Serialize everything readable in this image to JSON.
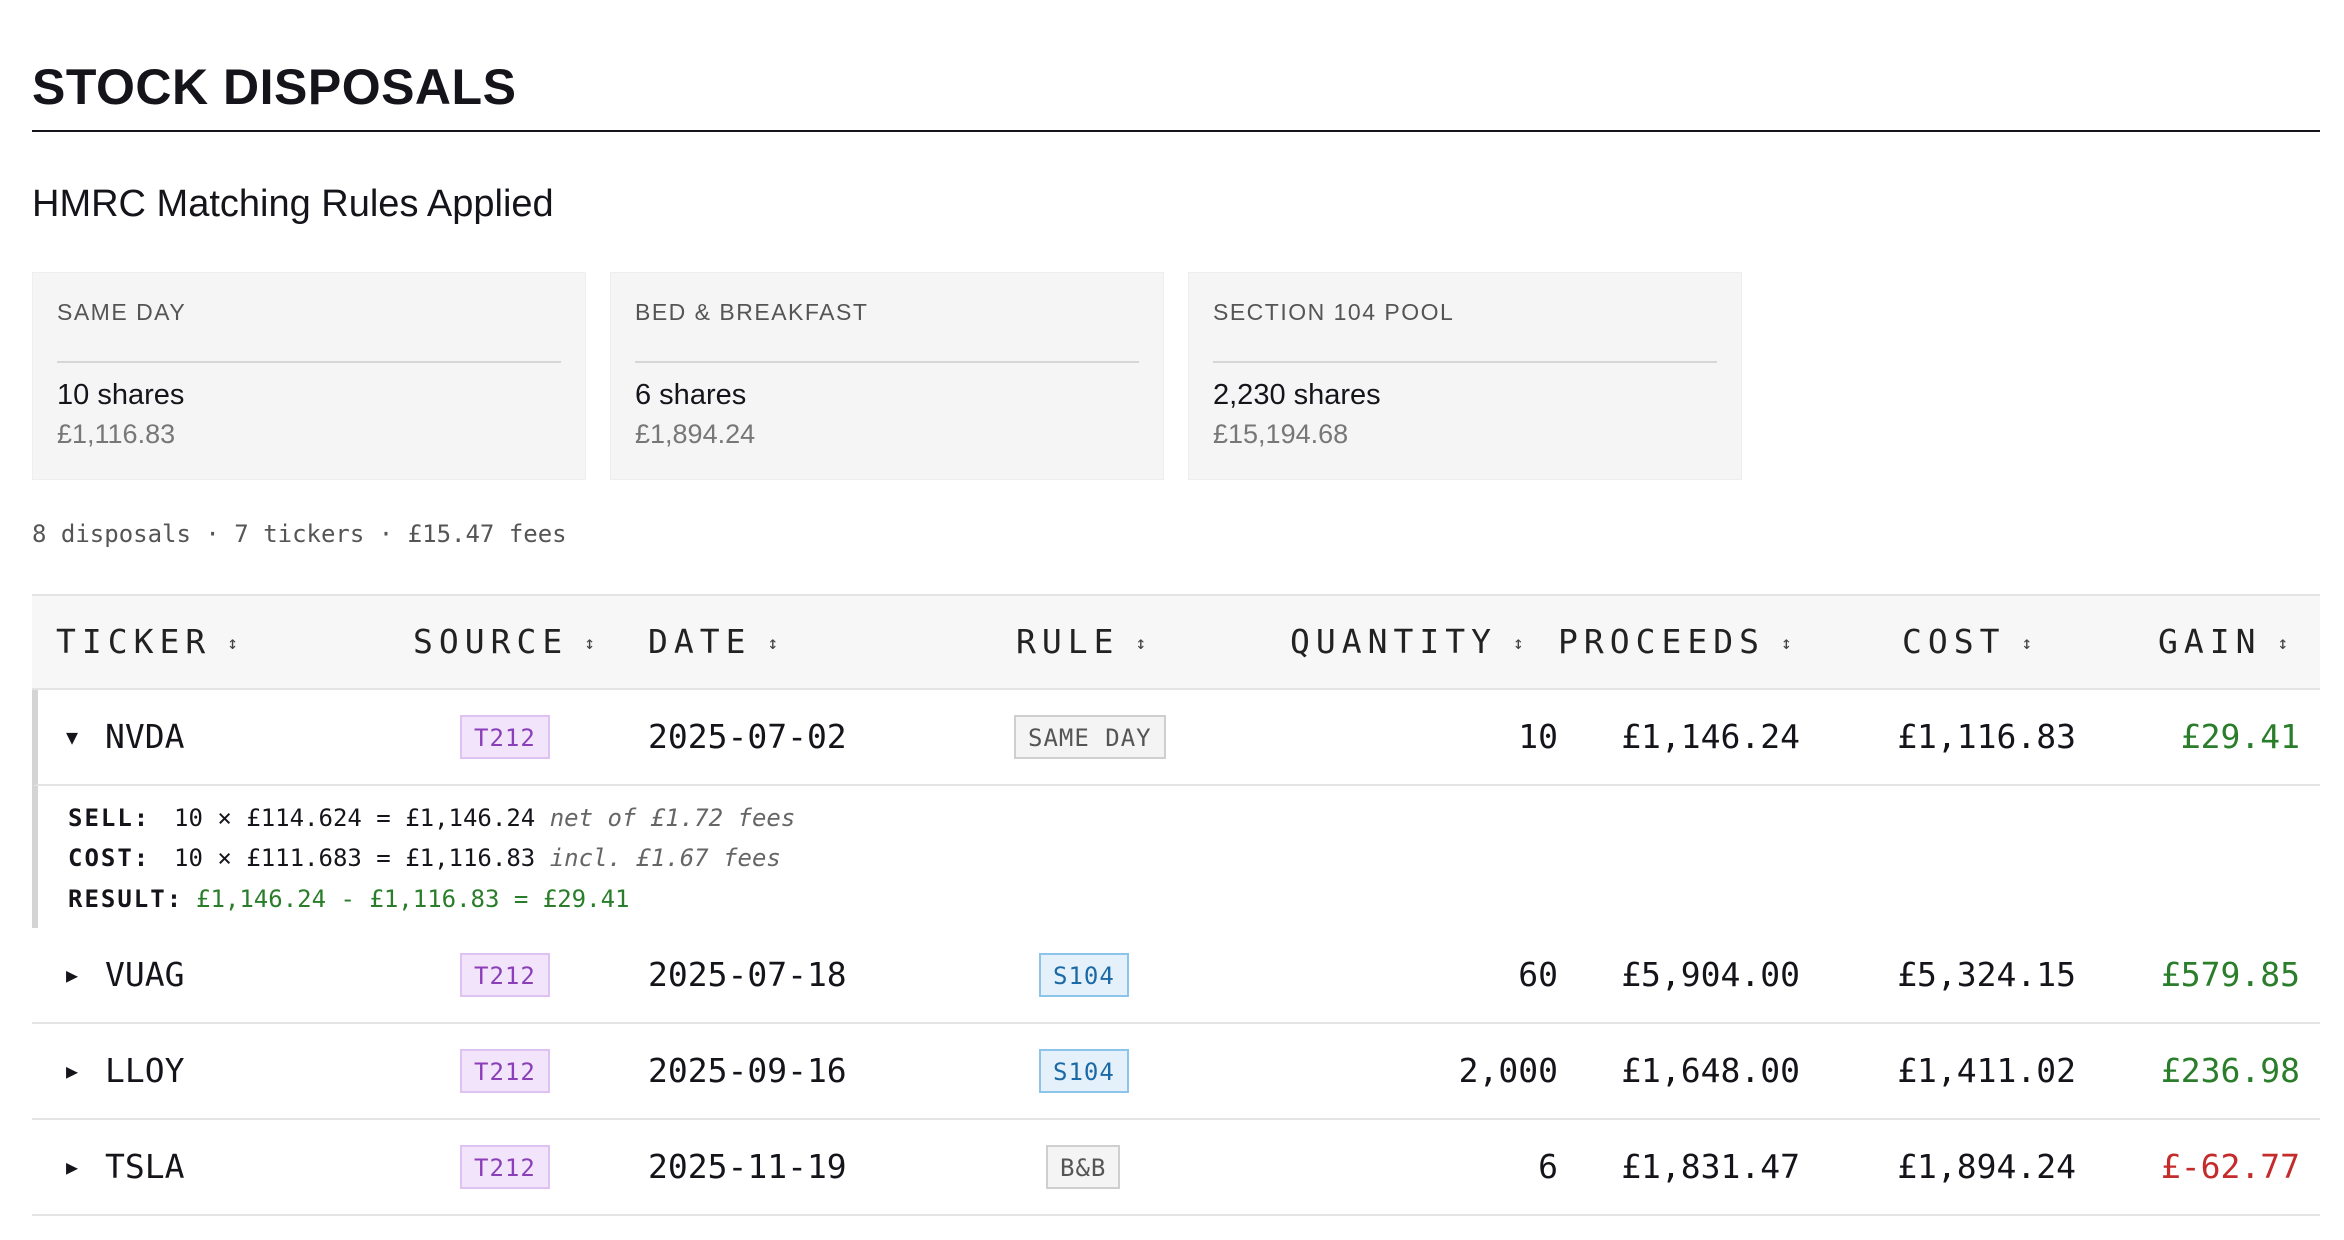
{
  "page": {
    "title": "STOCK DISPOSALS",
    "subtitle": "HMRC Matching Rules Applied",
    "meta": "8 disposals · 7 tickers · £15.47 fees"
  },
  "cards": [
    {
      "label": "SAME DAY",
      "shares": "10 shares",
      "amount": "£1,116.83"
    },
    {
      "label": "BED & BREAKFAST",
      "shares": "6 shares",
      "amount": "£1,894.24"
    },
    {
      "label": "SECTION 104 POOL",
      "shares": "2,230 shares",
      "amount": "£15,194.68"
    }
  ],
  "table": {
    "sort_icon": "↕",
    "headers": {
      "ticker": "TICKER",
      "source": "SOURCE",
      "date": "DATE",
      "rule": "RULE",
      "quantity": "QUANTITY",
      "proceeds": "PROCEEDS",
      "cost": "COST",
      "gain": "GAIN"
    },
    "rows": [
      {
        "caret": "▼",
        "ticker": "NVDA",
        "source": "T212",
        "date": "2025-07-02",
        "rule": "SAME DAY",
        "quantity": "10",
        "proceeds": "£1,146.24",
        "cost": "£1,116.83",
        "gain": "£29.41",
        "expanded": true
      },
      {
        "caret": "▶",
        "ticker": "VUAG",
        "source": "T212",
        "date": "2025-07-18",
        "rule": "S104",
        "quantity": "60",
        "proceeds": "£5,904.00",
        "cost": "£5,324.15",
        "gain": "£579.85"
      },
      {
        "caret": "▶",
        "ticker": "LLOY",
        "source": "T212",
        "date": "2025-09-16",
        "rule": "S104",
        "quantity": "2,000",
        "proceeds": "£1,648.00",
        "cost": "£1,411.02",
        "gain": "£236.98"
      },
      {
        "caret": "▶",
        "ticker": "TSLA",
        "source": "T212",
        "date": "2025-11-19",
        "rule": "B&B",
        "quantity": "6",
        "proceeds": "£1,831.47",
        "cost": "£1,894.24",
        "gain": "£-62.77"
      }
    ],
    "detail": {
      "sell_key": "SELL:",
      "sell_calc": "10 × £114.624 = £1,146.24",
      "sell_note": "net of £1.72 fees",
      "cost_key": "COST:",
      "cost_calc": "10 × £111.683 = £1,116.83",
      "cost_note": "incl. £1.67 fees",
      "result_key": "RESULT:",
      "result_calc": "£1,146.24 - £1,116.83 = £29.41"
    }
  },
  "colors": {
    "gain_positive": "#2a7d2a",
    "gain_negative": "#c42b2b",
    "tag_t212": "#8a3fb8",
    "tag_s104": "#1b6aa6"
  }
}
